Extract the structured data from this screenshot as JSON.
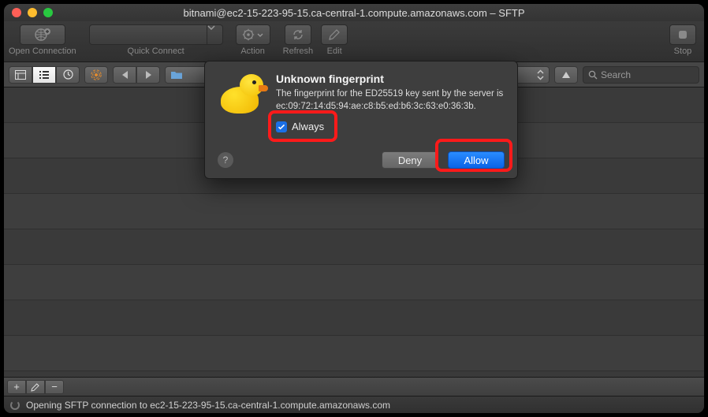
{
  "window": {
    "title": "bitnami@ec2-15-223-95-15.ca-central-1.compute.amazonaws.com – SFTP"
  },
  "toolbar": {
    "open_connection": "Open Connection",
    "quick_connect": "Quick Connect",
    "action": "Action",
    "refresh": "Refresh",
    "edit": "Edit",
    "stop": "Stop"
  },
  "secondary": {
    "search_placeholder": "Search"
  },
  "dialog": {
    "title": "Unknown fingerprint",
    "message": "The fingerprint for the ED25519 key sent by the server is ec:09:72:14:d5:94:ae:c8:b5:ed:b6:3c:63:e0:36:3b.",
    "always_label": "Always",
    "always_checked": true,
    "deny": "Deny",
    "allow": "Allow",
    "help": "?"
  },
  "bottom": {
    "add": "+",
    "edit_icon": "pencil",
    "remove": "−"
  },
  "status": {
    "text": "Opening SFTP connection to ec2-15-223-95-15.ca-central-1.compute.amazonaws.com"
  },
  "annotation": {
    "highlight_always": true,
    "highlight_allow": true
  }
}
